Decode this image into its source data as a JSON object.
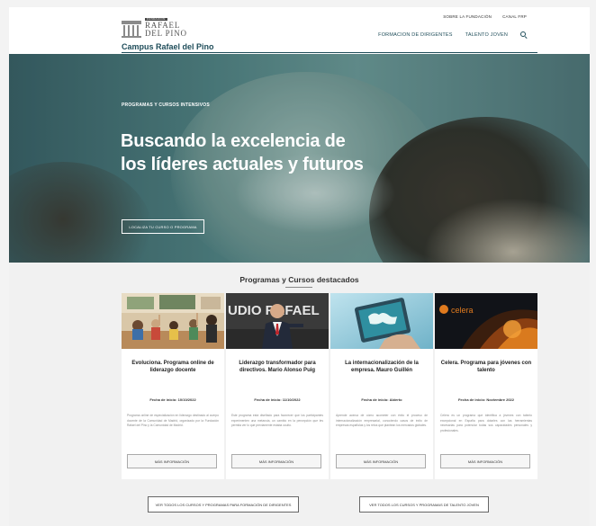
{
  "header": {
    "logo": {
      "tag": "FUNDACIÓN",
      "line1": "RAFAEL",
      "line2": "DEL PINO",
      "icon": "building-columns-icon"
    },
    "campus": "Campus Rafael del Pino",
    "top_nav": [
      "SOBRE LA FUNDACIÓN",
      "CANAL FRP"
    ],
    "main_nav": [
      "FORMACION DE DIRIGENTES",
      "TALENTO JOVEN"
    ],
    "search_icon": "search-icon"
  },
  "hero": {
    "kicker": "PROGRAMAS Y CURSOS INTENSIVOS",
    "title_line1": "Buscando la excelencia de",
    "title_line2": "los líderes actuales y futuros",
    "cta": "LOCALIZA TU CURSO O PROGRAMA"
  },
  "featured": {
    "title": "Programas y Cursos destacados",
    "cards": [
      {
        "title": "Evoluciona. Programa online de liderazgo docente",
        "date": "Fecha de inicio: 10/10/2022",
        "desc": "Programa online de especialización en liderazgo destinado al cuerpo docente de la Comunidad de Madrid, organizado por la Fundación Rafael del Pino y la Comunidad de Madrid.",
        "button": "MÁS INFORMACIÓN",
        "image_overlay": ""
      },
      {
        "title": "Liderazgo transformador para directivos. Mario Alonso Puig",
        "date": "Fecha de inicio: 11/10/2022",
        "desc": "Este programa está diseñado para favorecer que los participantes experimenten una metanoia, un cambio en la percepción que les permita ver lo que previamente estaba oculto.",
        "button": "MÁS INFORMACIÓN",
        "image_overlay": "UDIO  RAFAEL"
      },
      {
        "title": "La internacionalización de la empresa. Mauro Guillén",
        "date": "Fecha de inicio: Abierto",
        "desc": "Aprende acerca de cómo acometer con éxito el proceso de internacionalización empresarial, conociendo casos de éxito de empresas españolas y los retos que plantean los mercados globales.",
        "button": "MÁS INFORMACIÓN",
        "image_overlay": ""
      },
      {
        "title": "Celera. Programa para jóvenes con talento",
        "date": "Fecha de inicio: Noviembre 2022",
        "desc": "Celera es un programa que identifica a jóvenes con talento excepcional en España para dotarles con las herramientas necesarias para potenciar todas sus capacidades personales y profesionales.",
        "button": "MÁS INFORMACIÓN",
        "image_overlay": "celera"
      }
    ],
    "bottom_buttons": [
      "VER TODOS LOS CURSOS Y PROGRAMAS PARA FORMACIÓN DE DIRIGENTES",
      "VER TODOS LOS CURSOS Y PROGRAMAS DE TALENTO JOVEN"
    ]
  }
}
